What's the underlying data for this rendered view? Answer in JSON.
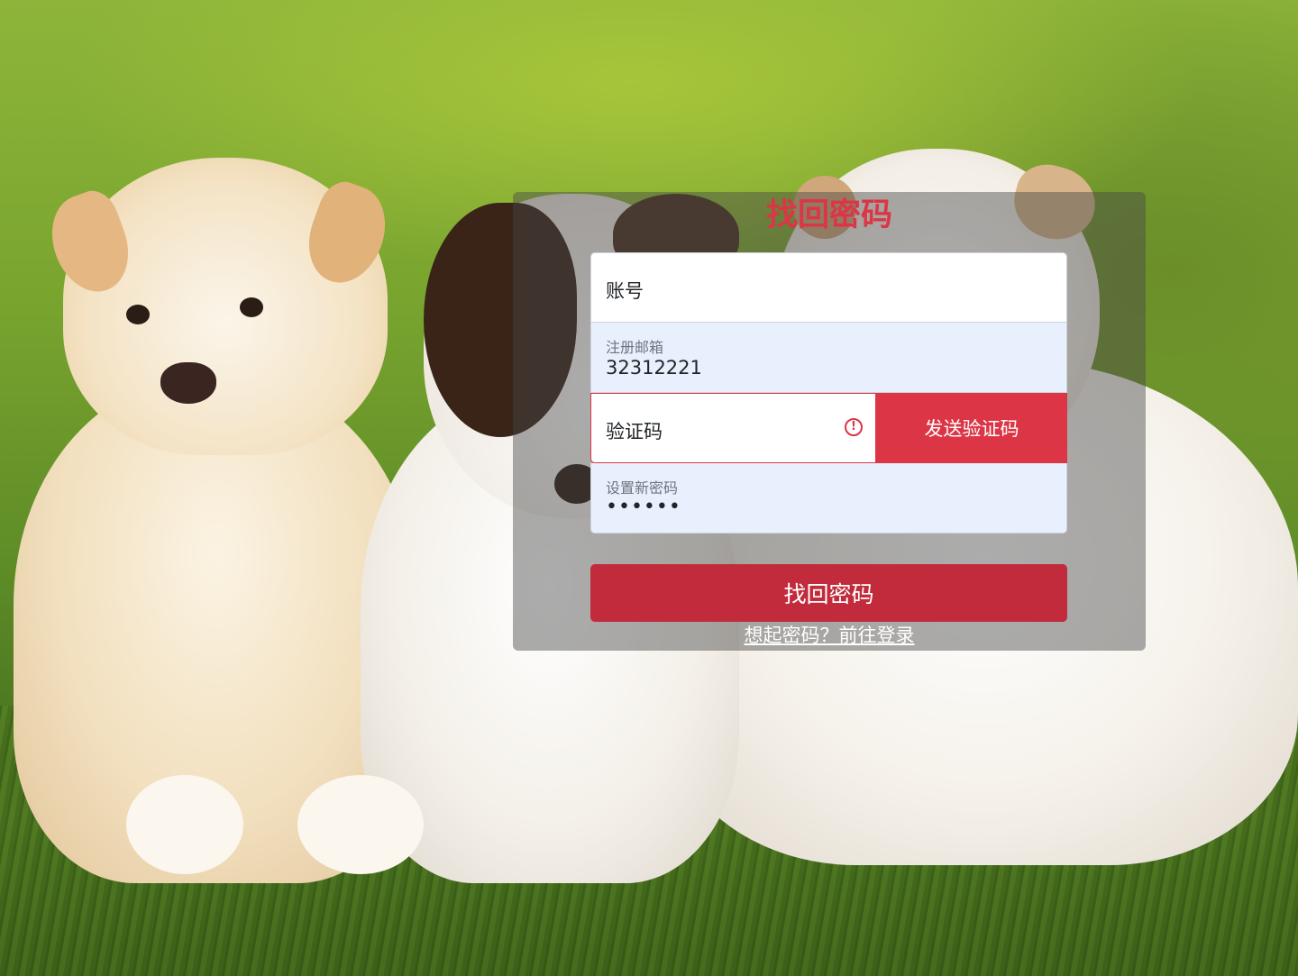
{
  "page": {
    "title": "找回密码"
  },
  "form": {
    "account": {
      "placeholder": "账号",
      "value": ""
    },
    "email": {
      "label": "注册邮箱",
      "value": "32312221"
    },
    "code": {
      "placeholder": "验证码",
      "value": "",
      "state": "invalid",
      "icon": "exclamation-circle-icon"
    },
    "send_code_label": "发送验证码",
    "new_password": {
      "label": "设置新密码",
      "value": "••••••"
    },
    "submit_label": "找回密码",
    "login_link": "想起密码？前往登录"
  },
  "colors": {
    "accent": "#dc3545",
    "submit": "#c22b3b",
    "autofill_bg": "#e8f0fe"
  }
}
